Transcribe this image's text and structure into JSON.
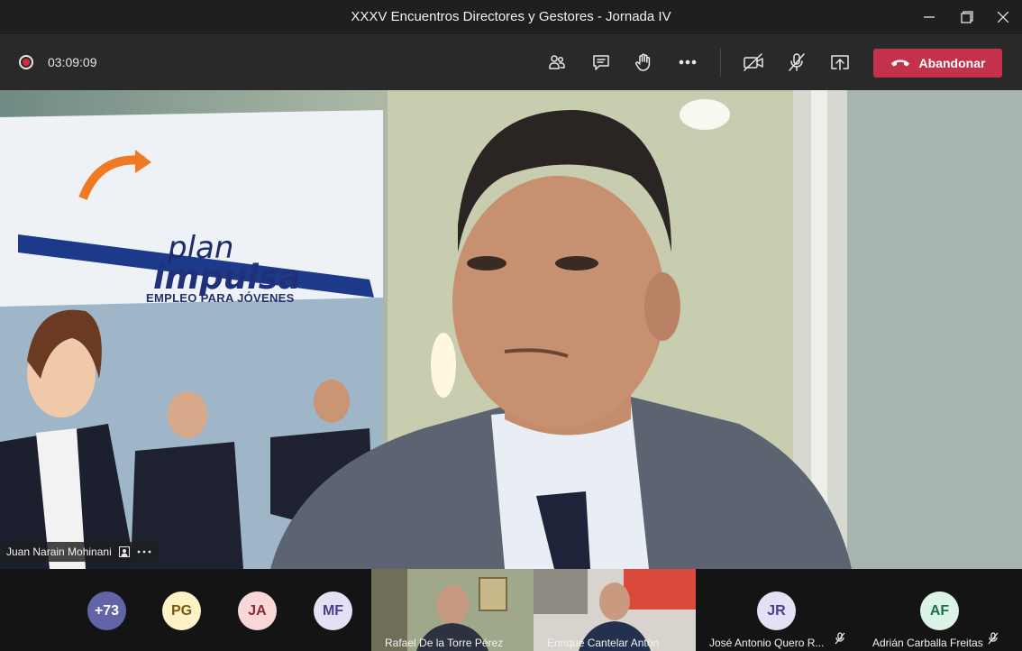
{
  "window": {
    "title": "XXXV Encuentros Directores y Gestores - Jornada IV"
  },
  "toolbar": {
    "elapsed": "03:09:09",
    "leave_label": "Abandonar",
    "icons": [
      "participants-icon",
      "chat-icon",
      "raise-hand-icon",
      "more-icon",
      "camera-off-icon",
      "mic-off-icon",
      "share-screen-icon",
      "hangup-icon"
    ]
  },
  "main_video": {
    "speaker_name": "Juan Narain Mohinani",
    "banner": {
      "line1": "plan",
      "line2": "impulsa",
      "line3": "EMPLEO PARA JÓVENES"
    }
  },
  "participants": [
    {
      "initials": "+73",
      "color": "#6264a7",
      "text_color": "#ffffff"
    },
    {
      "initials": "PG",
      "color": "#fdf3c7",
      "text_color": "#7a5a12"
    },
    {
      "initials": "JA",
      "color": "#f8d7d9",
      "text_color": "#8b2a33"
    },
    {
      "initials": "MF",
      "color": "#e5e1f4",
      "text_color": "#4a3f8a"
    },
    {
      "name": "Rafael De la Torre Pérez",
      "video": true
    },
    {
      "name": "Enrique Cantelar Antón",
      "video": true
    },
    {
      "initials": "JR",
      "name": "José Antonio Quero R...",
      "color": "#e5e1f4",
      "text_color": "#4a3f8a",
      "muted": true
    },
    {
      "initials": "AF",
      "name": "Adrián Carballa Freitas",
      "color": "#dcf3e8",
      "text_color": "#1f6e48",
      "muted": true
    }
  ]
}
